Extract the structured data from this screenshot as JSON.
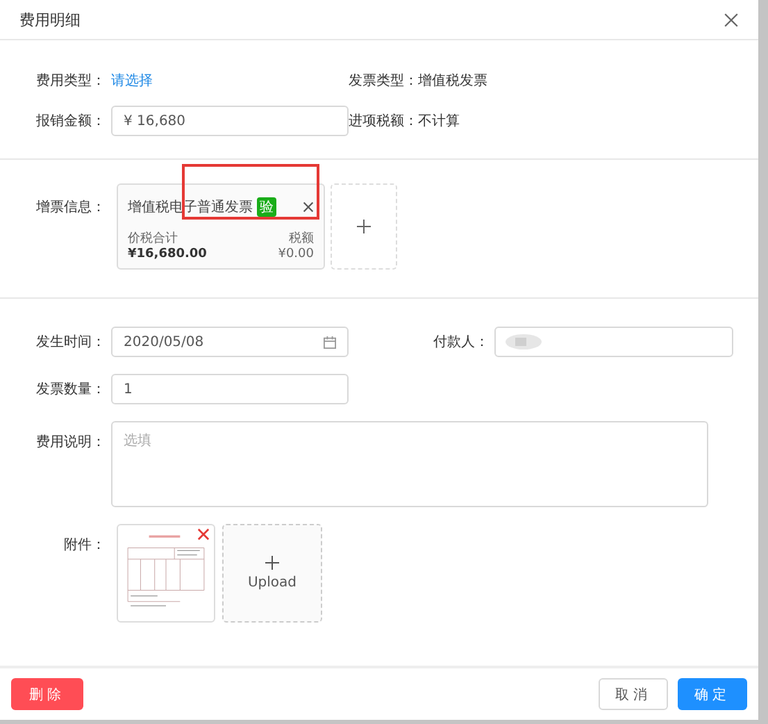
{
  "dialog": {
    "title": "费用明细"
  },
  "top_rows": [
    {
      "kind": "link",
      "label": "费用类型：",
      "value": "请选择"
    },
    {
      "kind": "text",
      "label": "发票类型：",
      "value": "增值税发票"
    },
    {
      "kind": "input",
      "label": "报销金额：",
      "value": "¥  16,680"
    },
    {
      "kind": "text",
      "label": "进项税额：",
      "value": "不计算"
    }
  ],
  "invoice": {
    "label": "增票信息：",
    "title": "增值税电子普通发票",
    "badge": "验",
    "total_label": "价税合计",
    "total": "¥16,680.00",
    "tax_label": "税额",
    "tax": "¥0.00",
    "highlighted": true
  },
  "details": {
    "date_label": "发生时间：",
    "date": "2020/05/08",
    "payer_label": "付款人：",
    "count_label": "发票数量：",
    "count": "1",
    "note_label": "费用说明：",
    "note_placeholder": "选填"
  },
  "attachments": {
    "label": "附件：",
    "upload": "Upload"
  },
  "footer": {
    "delete": "删除",
    "cancel": "取消",
    "confirm": "确定"
  }
}
